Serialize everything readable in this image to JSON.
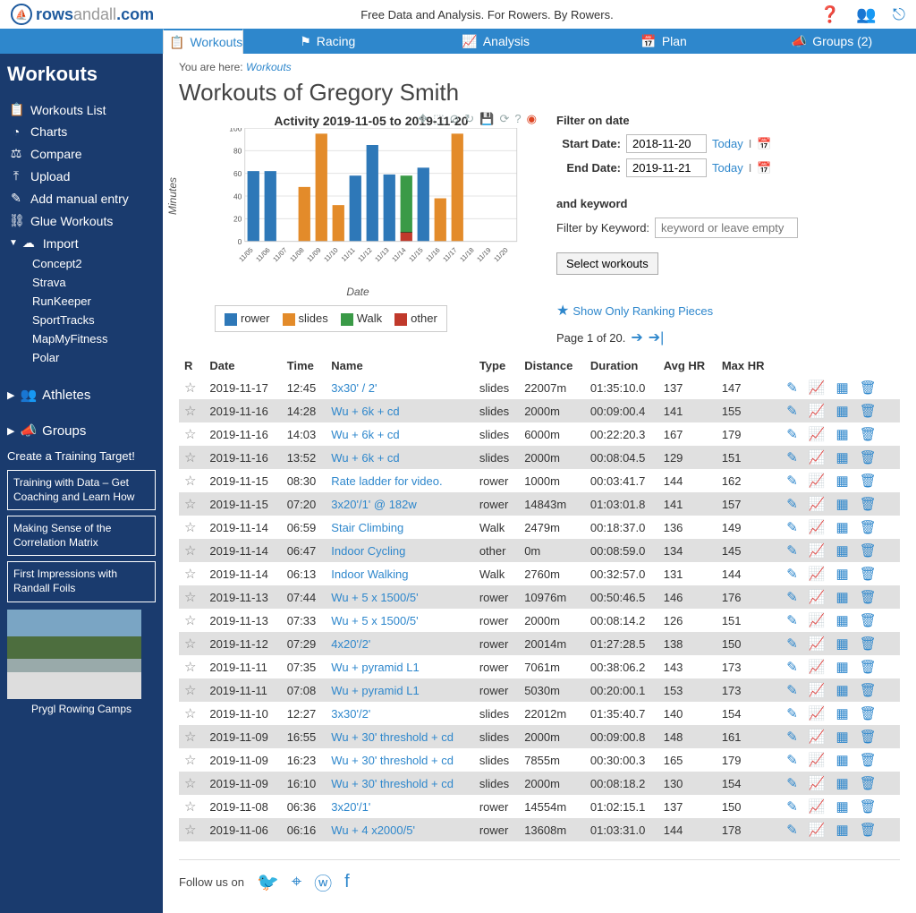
{
  "top": {
    "logo1": "rows",
    "logo2": "andall",
    "logo3": ".com",
    "tagline": "Free Data and Analysis. For Rowers. By Rowers."
  },
  "nav": {
    "workouts": "Workouts",
    "racing": "Racing",
    "analysis": "Analysis",
    "plan": "Plan",
    "groups": "Groups (2)"
  },
  "sidebar": {
    "heading": "Workouts",
    "items": [
      {
        "icon": "📋",
        "label": "Workouts List"
      },
      {
        "icon": "◔",
        "label": "Charts"
      },
      {
        "icon": "⚖",
        "label": "Compare"
      },
      {
        "icon": "⤒",
        "label": "Upload"
      },
      {
        "icon": "✎",
        "label": "Add manual entry"
      },
      {
        "icon": "⛓",
        "label": "Glue Workouts"
      },
      {
        "icon": "☁",
        "label": "Import"
      }
    ],
    "subs": [
      "Concept2",
      "Strava",
      "RunKeeper",
      "SportTracks",
      "MapMyFitness",
      "Polar"
    ],
    "athletes": "Athletes",
    "groups": "Groups",
    "create": "Create a Training Target!",
    "btns": [
      "Training with Data – Get Coaching and Learn How",
      "Making Sense of the Correlation Matrix",
      "First Impressions with Randall Foils"
    ],
    "promo": "Prygl Rowing Camps"
  },
  "bc": {
    "pre": "You are here:",
    "link": "Workouts"
  },
  "title": "Workouts of Gregory Smith",
  "chart_data": {
    "type": "bar",
    "title": "Activity 2019-11-05 to 2019-11-20",
    "xlabel": "Date",
    "ylabel": "Minutes",
    "ylim": [
      0,
      100
    ],
    "yticks": [
      0,
      20,
      40,
      60,
      80,
      100
    ],
    "categories": [
      "11/05",
      "11/06",
      "11/07",
      "11/08",
      "11/09",
      "11/10",
      "11/11",
      "11/12",
      "11/13",
      "11/14",
      "11/15",
      "11/16",
      "11/17",
      "11/18",
      "11/19",
      "11/20"
    ],
    "legend": [
      {
        "name": "rower",
        "color": "#2e78b8"
      },
      {
        "name": "slides",
        "color": "#e38b2a"
      },
      {
        "name": "Walk",
        "color": "#3a9a47"
      },
      {
        "name": "other",
        "color": "#c0392b"
      }
    ],
    "stacks": [
      [
        {
          "s": "rower",
          "v": 62
        }
      ],
      [
        {
          "s": "rower",
          "v": 62
        }
      ],
      [],
      [
        {
          "s": "slides",
          "v": 48
        }
      ],
      [
        {
          "s": "slides",
          "v": 95
        }
      ],
      [
        {
          "s": "slides",
          "v": 32
        }
      ],
      [
        {
          "s": "rower",
          "v": 58
        }
      ],
      [
        {
          "s": "rower",
          "v": 85
        }
      ],
      [
        {
          "s": "rower",
          "v": 59
        }
      ],
      [
        {
          "s": "other",
          "v": 8
        },
        {
          "s": "Walk",
          "v": 50
        }
      ],
      [
        {
          "s": "rower",
          "v": 65
        }
      ],
      [
        {
          "s": "slides",
          "v": 38
        }
      ],
      [
        {
          "s": "slides",
          "v": 95
        }
      ],
      [],
      [],
      []
    ]
  },
  "filter": {
    "head": "Filter on date",
    "start_l": "Start Date:",
    "start_v": "2018-11-20",
    "end_l": "End Date:",
    "end_v": "2019-11-21",
    "today": "Today",
    "kw_head": "and keyword",
    "kw_l": "Filter by Keyword:",
    "kw_ph": "keyword or leave empty",
    "btn": "Select workouts"
  },
  "rank": "Show Only Ranking Pieces",
  "pager": "Page 1 of 20.",
  "cols": {
    "r": "R",
    "date": "Date",
    "time": "Time",
    "name": "Name",
    "type": "Type",
    "dist": "Distance",
    "dur": "Duration",
    "ahr": "Avg HR",
    "mhr": "Max HR"
  },
  "rows": [
    {
      "date": "2019-11-17",
      "time": "12:45",
      "name": "3x30' / 2'",
      "type": "slides",
      "dist": "22007m",
      "dur": "01:35:10.0",
      "ahr": "137",
      "mhr": "147"
    },
    {
      "date": "2019-11-16",
      "time": "14:28",
      "name": "Wu + 6k + cd",
      "type": "slides",
      "dist": "2000m",
      "dur": "00:09:00.4",
      "ahr": "141",
      "mhr": "155"
    },
    {
      "date": "2019-11-16",
      "time": "14:03",
      "name": "Wu + 6k + cd",
      "type": "slides",
      "dist": "6000m",
      "dur": "00:22:20.3",
      "ahr": "167",
      "mhr": "179"
    },
    {
      "date": "2019-11-16",
      "time": "13:52",
      "name": "Wu + 6k + cd",
      "type": "slides",
      "dist": "2000m",
      "dur": "00:08:04.5",
      "ahr": "129",
      "mhr": "151"
    },
    {
      "date": "2019-11-15",
      "time": "08:30",
      "name": "Rate ladder for video.",
      "type": "rower",
      "dist": "1000m",
      "dur": "00:03:41.7",
      "ahr": "144",
      "mhr": "162"
    },
    {
      "date": "2019-11-15",
      "time": "07:20",
      "name": "3x20'/1' @ 182w",
      "type": "rower",
      "dist": "14843m",
      "dur": "01:03:01.8",
      "ahr": "141",
      "mhr": "157"
    },
    {
      "date": "2019-11-14",
      "time": "06:59",
      "name": "Stair Climbing",
      "type": "Walk",
      "dist": "2479m",
      "dur": "00:18:37.0",
      "ahr": "136",
      "mhr": "149"
    },
    {
      "date": "2019-11-14",
      "time": "06:47",
      "name": "Indoor Cycling",
      "type": "other",
      "dist": "0m",
      "dur": "00:08:59.0",
      "ahr": "134",
      "mhr": "145"
    },
    {
      "date": "2019-11-14",
      "time": "06:13",
      "name": "Indoor Walking",
      "type": "Walk",
      "dist": "2760m",
      "dur": "00:32:57.0",
      "ahr": "131",
      "mhr": "144"
    },
    {
      "date": "2019-11-13",
      "time": "07:44",
      "name": "Wu + 5 x 1500/5'",
      "type": "rower",
      "dist": "10976m",
      "dur": "00:50:46.5",
      "ahr": "146",
      "mhr": "176"
    },
    {
      "date": "2019-11-13",
      "time": "07:33",
      "name": "Wu + 5 x 1500/5'",
      "type": "rower",
      "dist": "2000m",
      "dur": "00:08:14.2",
      "ahr": "126",
      "mhr": "151"
    },
    {
      "date": "2019-11-12",
      "time": "07:29",
      "name": "4x20'/2'",
      "type": "rower",
      "dist": "20014m",
      "dur": "01:27:28.5",
      "ahr": "138",
      "mhr": "150"
    },
    {
      "date": "2019-11-11",
      "time": "07:35",
      "name": "Wu + pyramid L1",
      "type": "rower",
      "dist": "7061m",
      "dur": "00:38:06.2",
      "ahr": "143",
      "mhr": "173"
    },
    {
      "date": "2019-11-11",
      "time": "07:08",
      "name": "Wu + pyramid L1",
      "type": "rower",
      "dist": "5030m",
      "dur": "00:20:00.1",
      "ahr": "153",
      "mhr": "173"
    },
    {
      "date": "2019-11-10",
      "time": "12:27",
      "name": "3x30'/2'",
      "type": "slides",
      "dist": "22012m",
      "dur": "01:35:40.7",
      "ahr": "140",
      "mhr": "154"
    },
    {
      "date": "2019-11-09",
      "time": "16:55",
      "name": "Wu + 30' threshold + cd",
      "type": "slides",
      "dist": "2000m",
      "dur": "00:09:00.8",
      "ahr": "148",
      "mhr": "161"
    },
    {
      "date": "2019-11-09",
      "time": "16:23",
      "name": "Wu + 30' threshold + cd",
      "type": "slides",
      "dist": "7855m",
      "dur": "00:30:00.3",
      "ahr": "165",
      "mhr": "179"
    },
    {
      "date": "2019-11-09",
      "time": "16:10",
      "name": "Wu + 30' threshold + cd",
      "type": "slides",
      "dist": "2000m",
      "dur": "00:08:18.2",
      "ahr": "130",
      "mhr": "154"
    },
    {
      "date": "2019-11-08",
      "time": "06:36",
      "name": "3x20'/1'",
      "type": "rower",
      "dist": "14554m",
      "dur": "01:02:15.1",
      "ahr": "137",
      "mhr": "150"
    },
    {
      "date": "2019-11-06",
      "time": "06:16",
      "name": "Wu + 4 x2000/5'",
      "type": "rower",
      "dist": "13608m",
      "dur": "01:03:31.0",
      "ahr": "144",
      "mhr": "178"
    }
  ],
  "follow": "Follow us on"
}
